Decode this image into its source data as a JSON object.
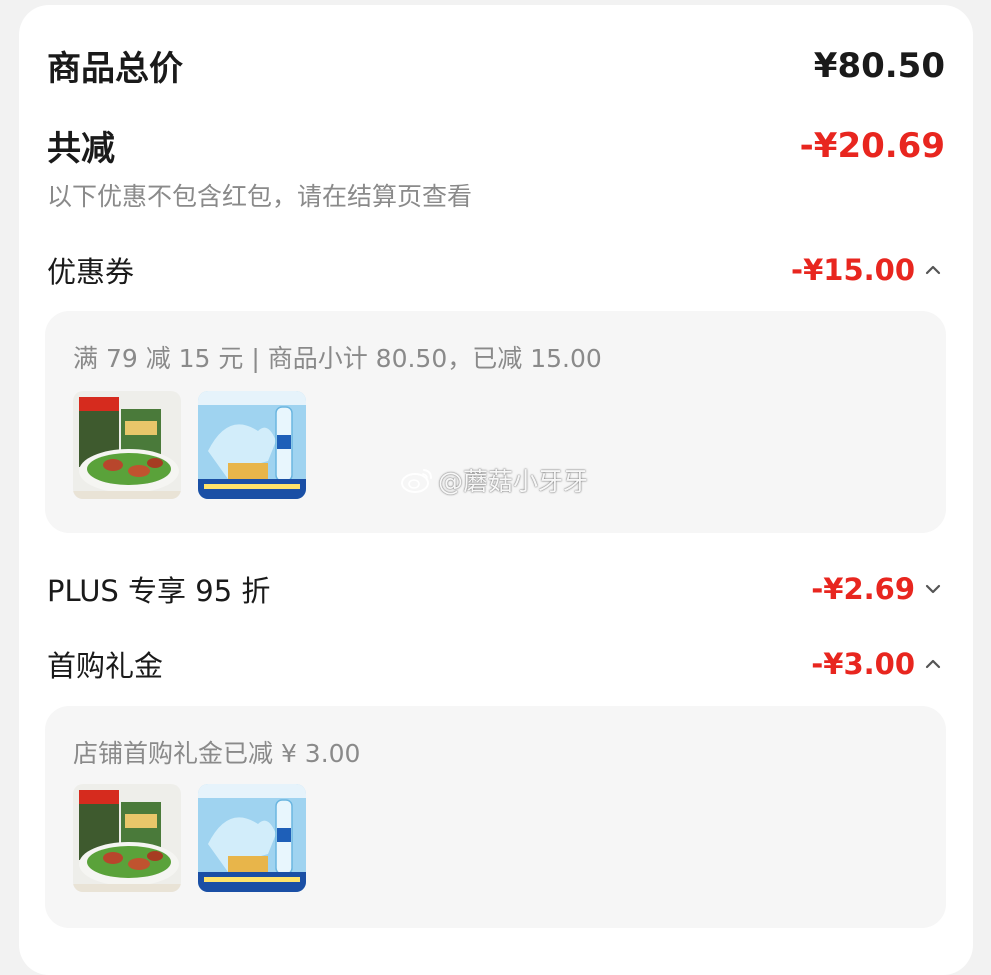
{
  "summary": {
    "total_label": "商品总价",
    "total_value": "¥80.50",
    "discount_label": "共减",
    "discount_value": "-¥20.69",
    "note": "以下优惠不包含红包，请在结算页查看"
  },
  "coupon": {
    "label": "优惠券",
    "value": "-¥15.00",
    "expanded": true,
    "detail": "满 79 减 15 元 | 商品小计 80.50，已减 15.00",
    "products": [
      "product-seasoning-pack",
      "product-water-bottle"
    ]
  },
  "plus": {
    "label": "PLUS 专享 95 折",
    "value": "-¥2.69",
    "expanded": false
  },
  "first_purchase": {
    "label": "首购礼金",
    "value": "-¥3.00",
    "expanded": true,
    "detail": "店铺首购礼金已减 ¥ 3.00",
    "products": [
      "product-seasoning-pack",
      "product-water-bottle"
    ]
  },
  "watermark": {
    "icon": "weibo-icon",
    "text": "@蘑菇小牙牙"
  },
  "colors": {
    "accent_red": "#e8261f",
    "text_primary": "#1a1a1a",
    "text_secondary": "#8a8a8a",
    "panel_bg": "#f6f6f6",
    "card_bg": "#ffffff",
    "page_bg": "#f2f2f2"
  }
}
